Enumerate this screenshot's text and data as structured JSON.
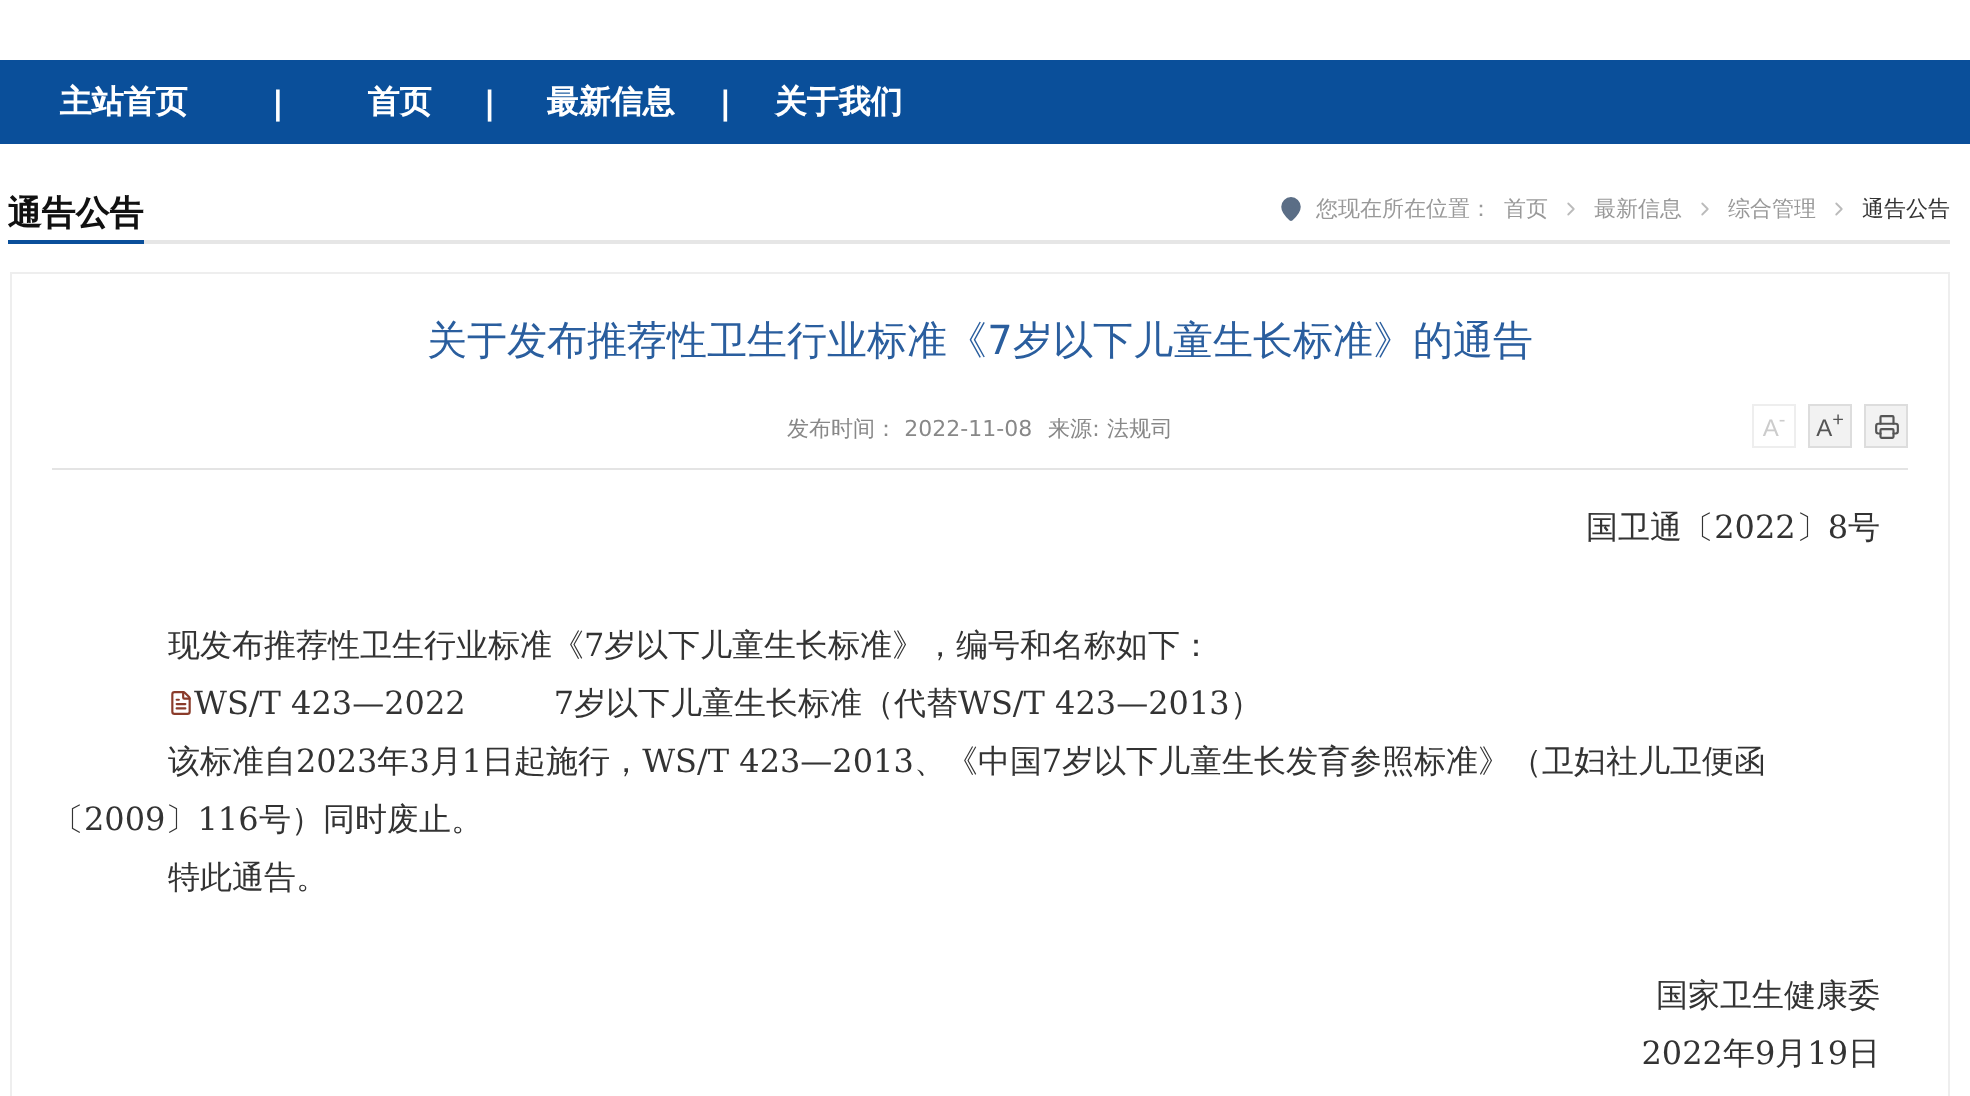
{
  "nav": {
    "items": [
      {
        "label": "主站首页"
      },
      {
        "label": "首页"
      },
      {
        "label": "最新信息"
      },
      {
        "label": "关于我们"
      }
    ],
    "separator": "|"
  },
  "section": {
    "title": "通告公告"
  },
  "breadcrumb": {
    "prefix": "您现在所在位置：",
    "items": [
      {
        "label": "首页",
        "selected": false
      },
      {
        "label": "最新信息",
        "selected": false
      },
      {
        "label": "综合管理",
        "selected": false
      },
      {
        "label": "通告公告",
        "selected": true
      }
    ]
  },
  "article": {
    "title": "关于发布推荐性卫生行业标准《7岁以下儿童生长标准》的通告",
    "meta": [
      {
        "label": "发布时间：",
        "value": "2022-11-08"
      },
      {
        "label": "来源:",
        "value": "法规司"
      }
    ],
    "tools": [
      {
        "kind": "text",
        "label": "A$^{-}$",
        "disabled": true
      },
      {
        "kind": "text",
        "label": "A$^{+}$",
        "disabled": false
      },
      {
        "kind": "print",
        "disabled": false
      }
    ],
    "doc_number": "国卫通〔2022〕8号",
    "paragraphs": [
      {
        "kind": "text",
        "text": "现发布推荐性卫生行业标准《7岁以下儿童生长标准》，编号和名称如下："
      },
      {
        "kind": "attachment",
        "code": "WS/T 423—2022",
        "text": "7岁以下儿童生长标准（代替WS/T 423—2013）"
      },
      {
        "kind": "text",
        "text": "该标准自2023年3月1日起施行，WS/T 423—2013、《中国7岁以下儿童生长发育参照标准》（卫妇社儿卫便函〔2009〕116号）同时废止。"
      },
      {
        "kind": "text",
        "text": "特此通告。"
      }
    ],
    "signature": "国家卫生健康委",
    "date": "2022年9月19日"
  }
}
